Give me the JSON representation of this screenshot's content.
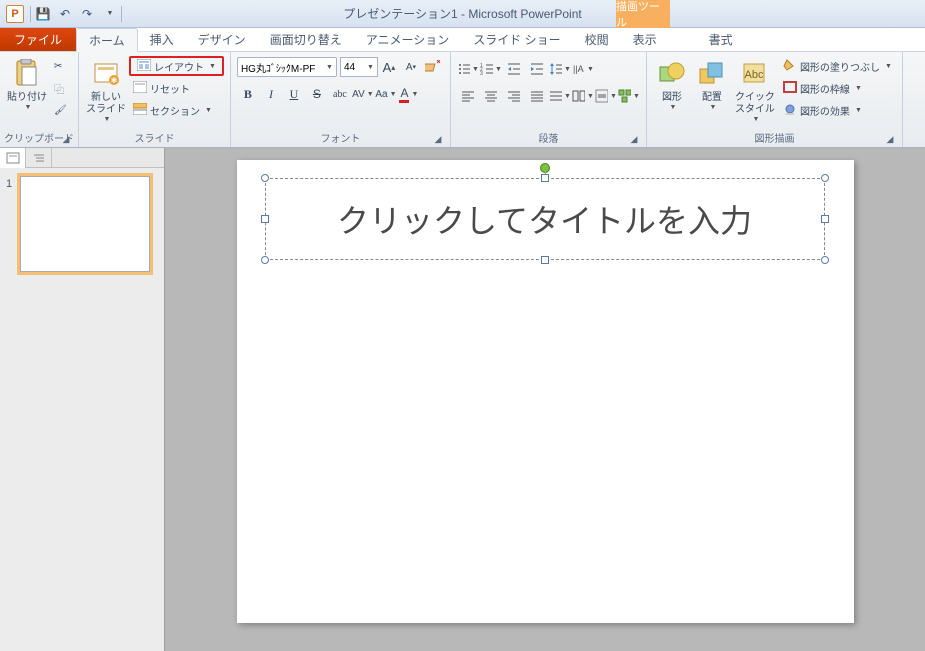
{
  "app": {
    "icon_letter": "P",
    "title": "プレゼンテーション1 - Microsoft PowerPoint",
    "context_tool_title": "描画ツール"
  },
  "qat": {
    "save_icon": "💾",
    "undo_icon": "↶",
    "redo_icon": "↷"
  },
  "tabs": {
    "file": "ファイル",
    "home": "ホーム",
    "insert": "挿入",
    "design": "デザイン",
    "transitions": "画面切り替え",
    "animations": "アニメーション",
    "slideshow": "スライド ショー",
    "review": "校閲",
    "view": "表示",
    "format": "書式"
  },
  "ribbon": {
    "clipboard": {
      "label": "クリップボード",
      "paste": "貼り付け",
      "cut_icon": "✂",
      "copy_icon": "⿻",
      "brush_icon": "🖌"
    },
    "slides": {
      "label": "スライド",
      "new_slide": "新しい\nスライド",
      "layout": "レイアウト",
      "reset": "リセット",
      "section": "セクション"
    },
    "font": {
      "label": "フォント",
      "name": "HG丸ｺﾞｼｯｸM-PF",
      "size": "44",
      "bold": "B",
      "italic": "I",
      "underline": "U",
      "strike": "S",
      "shadow": "abc",
      "spacing": "AV",
      "case": "Aa",
      "color": "A",
      "grow": "A",
      "shrink": "A",
      "clear": "Aᵪ"
    },
    "paragraph": {
      "label": "段落"
    },
    "drawing": {
      "label": "図形描画",
      "shapes": "図形",
      "arrange": "配置",
      "quick_styles": "クイック\nスタイル",
      "fill": "図形の塗りつぶし",
      "outline": "図形の枠線",
      "effects": "図形の効果"
    }
  },
  "thumb": {
    "slide_num": "1"
  },
  "slide": {
    "title_placeholder": "クリックしてタイトルを入力"
  }
}
